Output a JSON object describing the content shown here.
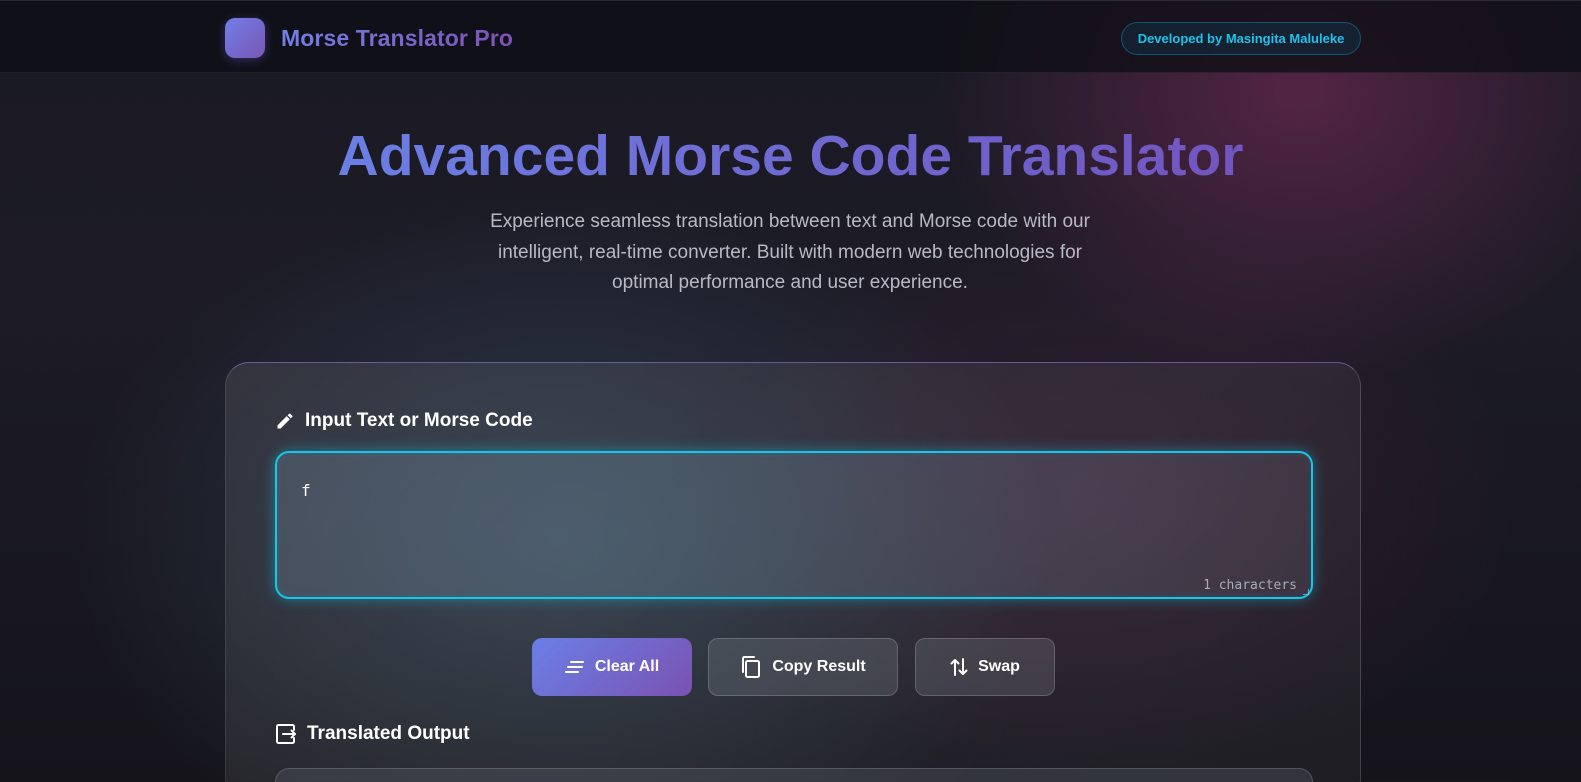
{
  "header": {
    "app_name": "Morse Translator Pro",
    "badge": "Developed by Masingita Maluleke"
  },
  "hero": {
    "title": "Advanced Morse Code Translator",
    "subtitle": "Experience seamless translation between text and Morse code with our intelligent, real-time converter. Built with modern web technologies for optimal performance and user experience."
  },
  "input": {
    "label": "Input Text or Morse Code",
    "value": "f",
    "char_count": "1 characters",
    "label_icon": "pencil-icon"
  },
  "actions": {
    "clear_label": "Clear All",
    "copy_label": "Copy Result",
    "swap_label": "Swap",
    "clear_icon": "clear-lines-icon",
    "copy_icon": "copy-icon",
    "swap_icon": "swap-arrows-icon"
  },
  "output": {
    "label": "Translated Output",
    "label_icon": "export-icon"
  },
  "colors": {
    "accent_start": "#6b7fe6",
    "accent_end": "#7a52b2",
    "focus_cyan": "#16c7ea"
  }
}
